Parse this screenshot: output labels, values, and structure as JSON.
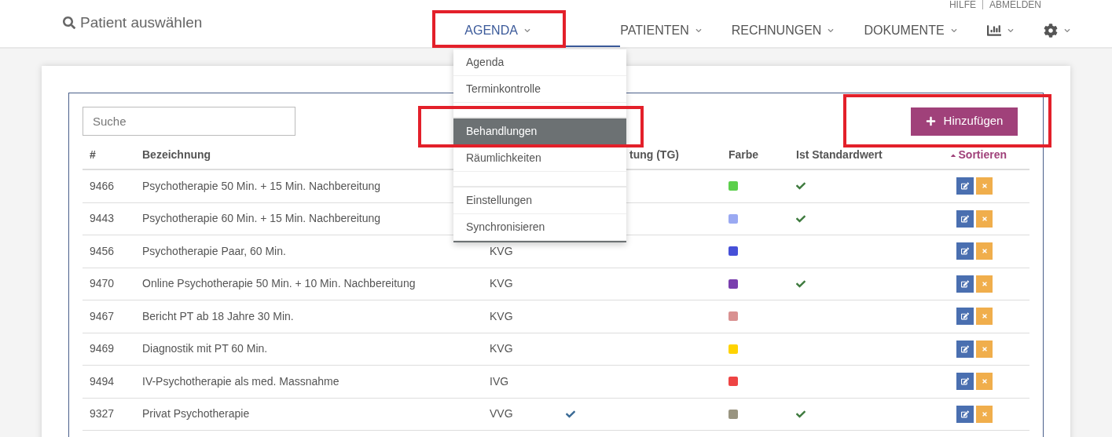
{
  "top_links": [
    {
      "label": "HILFE"
    },
    {
      "label": "ABMELDEN"
    }
  ],
  "patient_search": {
    "label": "Patient auswählen"
  },
  "nav": [
    {
      "kind": "text",
      "label": "AGENDA",
      "selected": true
    },
    {
      "kind": "text",
      "label": "PATIENTEN",
      "selected": false
    },
    {
      "kind": "text",
      "label": "RECHNUNGEN",
      "selected": false
    },
    {
      "kind": "text",
      "label": "DOKUMENTE",
      "selected": false
    },
    {
      "kind": "chart",
      "selected": false
    },
    {
      "kind": "settings",
      "selected": false
    }
  ],
  "dropdown": [
    {
      "kind": "item",
      "label": "Agenda",
      "selected": false
    },
    {
      "kind": "item",
      "label": "Terminkontrolle",
      "selected": false
    },
    {
      "kind": "divider"
    },
    {
      "kind": "item",
      "label": "Behandlungen",
      "selected": true
    },
    {
      "kind": "item",
      "label": "Räumlichkeiten",
      "selected": false
    },
    {
      "kind": "divider"
    },
    {
      "kind": "item",
      "label": "Einstellungen",
      "selected": false
    },
    {
      "kind": "item",
      "label": "Synchronisieren",
      "selected": false
    }
  ],
  "search": {
    "placeholder": "Suche"
  },
  "add_button": {
    "label": "Hinzufügen"
  },
  "table": {
    "columns": [
      "#",
      "Bezeichnung",
      "tung (TG)",
      "Farbe",
      "Ist Standardwert",
      "Sortieren"
    ],
    "rows": [
      {
        "id": "9466",
        "name": "Psychotherapie 50 Min. + 15 Min. Nachbereitung",
        "color": "#5ccf4c",
        "default": true
      },
      {
        "id": "9443",
        "name": "Psychotherapie 60 Min. + 15 Min. Nachbereitung",
        "color": "#9aa9f2",
        "default": true
      },
      {
        "id": "9456",
        "name": "Psychotherapie Paar, 60 Min.",
        "column_3": "KVG",
        "color": "#4650d8",
        "default": false
      },
      {
        "id": "9470",
        "name": "Online Psychotherapie 50 Min. + 10 Min. Nachbereitung",
        "column_3": "KVG",
        "tg": false,
        "color": "#7a3fae",
        "default": true
      },
      {
        "id": "9467",
        "name": "Bericht PT ab 18 Jahre 30 Min.",
        "column_3": "KVG",
        "tg": false,
        "color": "#d99191",
        "default": false
      },
      {
        "id": "9469",
        "name": "Diagnostik mit PT 60 Min.",
        "column_3": "KVG",
        "tg": false,
        "color": "#ffd300",
        "default": false
      },
      {
        "id": "9494",
        "name": "IV-Psychotherapie als med. Massnahme",
        "column_3": "IVG",
        "tg": false,
        "color": "#ee4444",
        "default": false
      },
      {
        "id": "9327",
        "name": "Privat Psychotherapie",
        "column_3": "VVG",
        "tg": true,
        "color": "#999480",
        "default": true
      }
    ]
  }
}
